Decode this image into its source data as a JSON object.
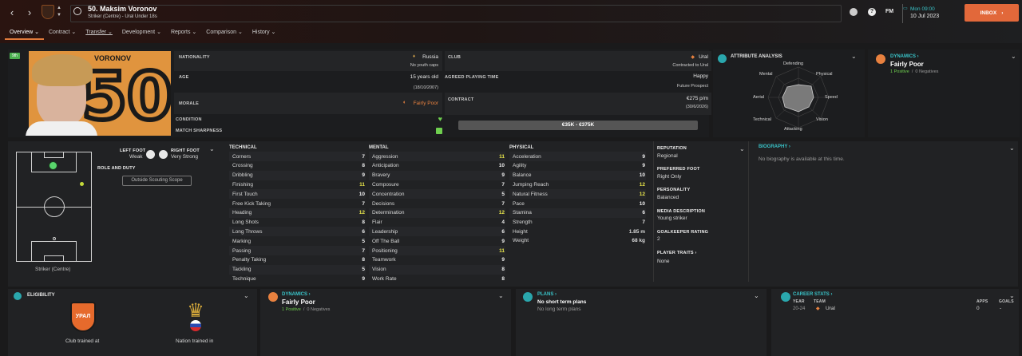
{
  "header": {
    "player_title": "50. Maksim Voronov",
    "subtitle": "Striker (Centre) - Ural Under 18s",
    "date_time": "Mon 09:00",
    "date": "10 Jul 2023",
    "inbox": "INBOX",
    "fm_label": "FM"
  },
  "menu": [
    {
      "label": "Overview ⌄"
    },
    {
      "label": "Contract ⌄"
    },
    {
      "label": "Transfer ⌄"
    },
    {
      "label": "Development ⌄"
    },
    {
      "label": "Reports ⌄"
    },
    {
      "label": "Comparison ⌄"
    },
    {
      "label": "History ⌄"
    }
  ],
  "profile": {
    "surname": "VORONOV",
    "shirt_number": "50",
    "badge": "9th",
    "nationality_label": "NATIONALITY",
    "nationality": "Russia",
    "caps": "No youth caps",
    "age_label": "AGE",
    "age": "15 years old",
    "dob": "(18/10/2007)",
    "morale_label": "MORALE",
    "morale": "Fairly Poor",
    "condition_label": "CONDITION",
    "sharpness_label": "MATCH SHARPNESS",
    "club_label": "CLUB",
    "club": "Ural",
    "club_contract": "Contracted to Ural",
    "apt_label": "AGREED PLAYING TIME",
    "apt": "Happy",
    "apt_sub": "Future Prospect",
    "contract_label": "CONTRACT",
    "wage": "€275 p/m",
    "expiry": "(30/6/2026)",
    "value_range": "€35K - €375K"
  },
  "attr_analysis": {
    "title": "ATTRIBUTE ANALYSIS",
    "labels": [
      "Defending",
      "Physical",
      "Speed",
      "Vision",
      "Attacking",
      "Technical",
      "Aerial",
      "Mental"
    ]
  },
  "dynamics_top": {
    "title": "DYNAMICS ›",
    "value": "Fairly Poor",
    "positive": "1 Positive",
    "sep": "/",
    "negative": "0 Negatives"
  },
  "pitch": {
    "position": "Striker (Centre)",
    "left_foot_label": "LEFT FOOT",
    "left_foot": "Weak",
    "right_foot_label": "RIGHT FOOT",
    "right_foot": "Very Strong",
    "role_label": "ROLE AND DUTY",
    "scope_btn": "Outside Scouting Scope"
  },
  "technical": {
    "title": "TECHNICAL",
    "items": [
      [
        "Corners",
        "7",
        ""
      ],
      [
        "Crossing",
        "8",
        ""
      ],
      [
        "Dribbling",
        "9",
        ""
      ],
      [
        "Finishing",
        "11",
        "hl"
      ],
      [
        "First Touch",
        "10",
        ""
      ],
      [
        "Free Kick Taking",
        "7",
        ""
      ],
      [
        "Heading",
        "12",
        "hl"
      ],
      [
        "Long Shots",
        "8",
        ""
      ],
      [
        "Long Throws",
        "6",
        ""
      ],
      [
        "Marking",
        "5",
        "dim"
      ],
      [
        "Passing",
        "7",
        ""
      ],
      [
        "Penalty Taking",
        "8",
        ""
      ],
      [
        "Tackling",
        "5",
        "dim"
      ],
      [
        "Technique",
        "9",
        ""
      ]
    ]
  },
  "mental": {
    "title": "MENTAL",
    "items": [
      [
        "Aggression",
        "11",
        "hl"
      ],
      [
        "Anticipation",
        "10",
        ""
      ],
      [
        "Bravery",
        "9",
        ""
      ],
      [
        "Composure",
        "7",
        ""
      ],
      [
        "Concentration",
        "5",
        "dim"
      ],
      [
        "Decisions",
        "7",
        ""
      ],
      [
        "Determination",
        "12",
        "hl"
      ],
      [
        "Flair",
        "4",
        "dim"
      ],
      [
        "Leadership",
        "6",
        ""
      ],
      [
        "Off The Ball",
        "9",
        ""
      ],
      [
        "Positioning",
        "11",
        "hl"
      ],
      [
        "Teamwork",
        "9",
        ""
      ],
      [
        "Vision",
        "8",
        ""
      ],
      [
        "Work Rate",
        "8",
        ""
      ]
    ]
  },
  "physical": {
    "title": "PHYSICAL",
    "items": [
      [
        "Acceleration",
        "9",
        ""
      ],
      [
        "Agility",
        "9",
        ""
      ],
      [
        "Balance",
        "10",
        ""
      ],
      [
        "Jumping Reach",
        "12",
        "hl"
      ],
      [
        "Natural Fitness",
        "12",
        "hl"
      ],
      [
        "Pace",
        "10",
        ""
      ],
      [
        "Stamina",
        "6",
        ""
      ],
      [
        "Strength",
        "7",
        ""
      ]
    ],
    "height_label": "Height",
    "height": "1.85 m",
    "weight_label": "Weight",
    "weight": "68 kg"
  },
  "info": {
    "reputation_label": "REPUTATION",
    "reputation": "Regional",
    "pref_foot_label": "PREFERRED FOOT",
    "pref_foot": "Right Only",
    "personality_label": "PERSONALITY",
    "personality": "Balanced",
    "media_label": "MEDIA DESCRIPTION",
    "media": "Young striker",
    "gk_label": "GOALKEEPER RATING",
    "gk": "2",
    "traits_label": "PLAYER TRAITS ›",
    "traits": "None"
  },
  "biography": {
    "title": "BIOGRAPHY ›",
    "text": "No biography is available at this time."
  },
  "eligibility": {
    "title": "ELIGIBILITY",
    "club_trained": "Club trained at",
    "nation_trained": "Nation trained in",
    "club_badge_text": "УРАЛ"
  },
  "dynamics_bottom": {
    "title": "DYNAMICS ›",
    "value": "Fairly Poor",
    "positive": "1 Positive",
    "sep": "/",
    "negative": "0 Negatives"
  },
  "plans": {
    "title": "PLANS ›",
    "short": "No short term plans",
    "long": "No long term plans"
  },
  "career": {
    "title": "CAREER STATS ›",
    "col_year": "YEAR",
    "col_team": "TEAM",
    "col_apps": "APPS",
    "col_goals": "GOALS",
    "year": "20-24",
    "team": "Ural",
    "apps": "0",
    "goals": "-"
  }
}
